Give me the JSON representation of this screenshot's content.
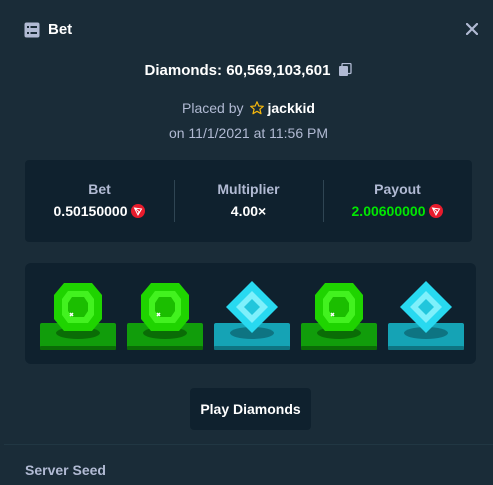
{
  "header": {
    "title": "Bet"
  },
  "summary": {
    "diamonds_text": "Diamonds: 60,569,103,601",
    "placed_by_prefix": "Placed by",
    "username": "jackkid",
    "date_text": "on 11/1/2021 at 11:56 PM"
  },
  "stats": {
    "bet": {
      "label": "Bet",
      "value": "0.50150000"
    },
    "multiplier": {
      "label": "Multiplier",
      "value": "4.00×"
    },
    "payout": {
      "label": "Payout",
      "value": "2.00600000"
    }
  },
  "board": {
    "gems": [
      "green",
      "green",
      "cyan",
      "green",
      "cyan"
    ]
  },
  "colors": {
    "payout_green": "#00e701",
    "coin_red": "#e81b2c",
    "gem_green": "#1fd400",
    "gem_cyan": "#28d9f0"
  },
  "play_button": {
    "label": "Play Diamonds"
  },
  "server_seed": {
    "label": "Server Seed"
  }
}
